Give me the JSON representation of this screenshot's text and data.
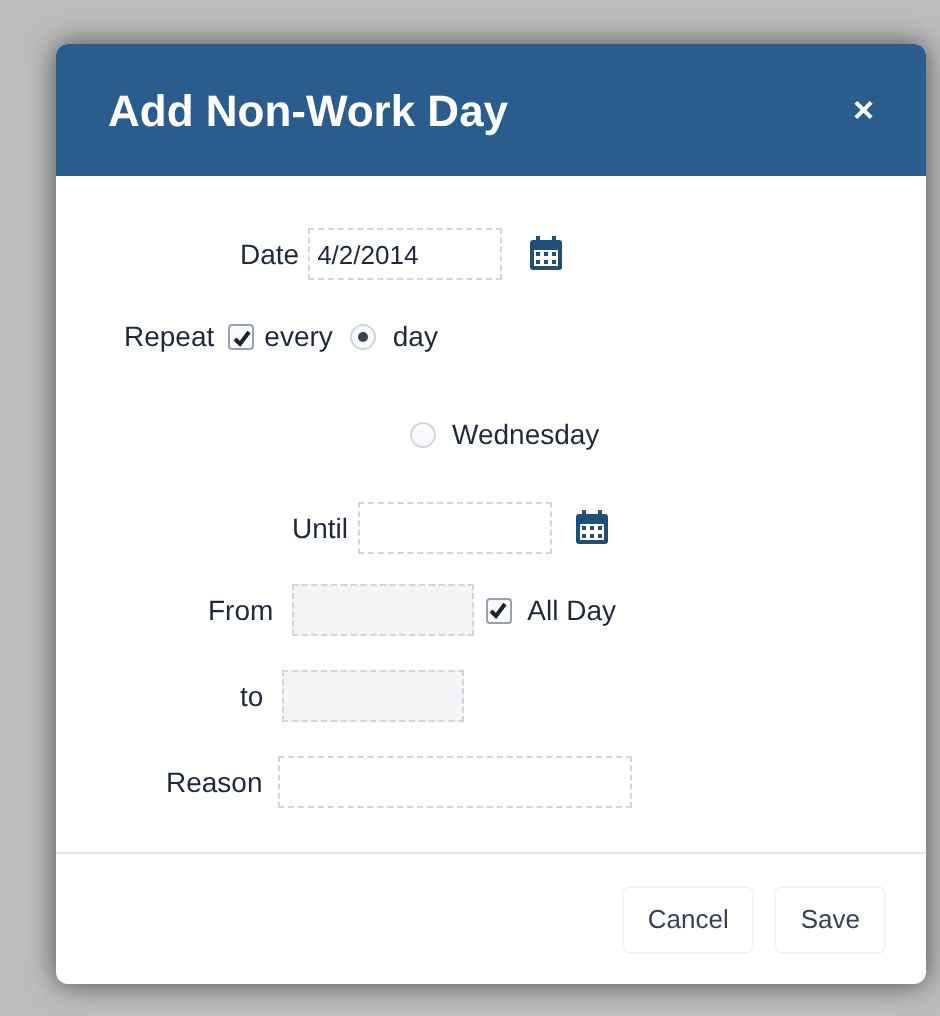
{
  "dialog": {
    "title": "Add Non-Work Day",
    "close": "×"
  },
  "date": {
    "label": "Date",
    "value": "4/2/2014"
  },
  "repeat": {
    "label": "Repeat",
    "checked": true,
    "every_label": "every"
  },
  "frequency": [
    {
      "label": "day",
      "selected": true
    },
    {
      "label": "Wednesday",
      "selected": false
    }
  ],
  "until": {
    "label": "Until"
  },
  "from": {
    "label": "From",
    "disabled": true
  },
  "all_day": {
    "label": "All Day",
    "checked": true
  },
  "to": {
    "label": "to",
    "disabled": true
  },
  "reason": {
    "label": "Reason"
  },
  "buttons": [
    "Cancel",
    "Save"
  ]
}
